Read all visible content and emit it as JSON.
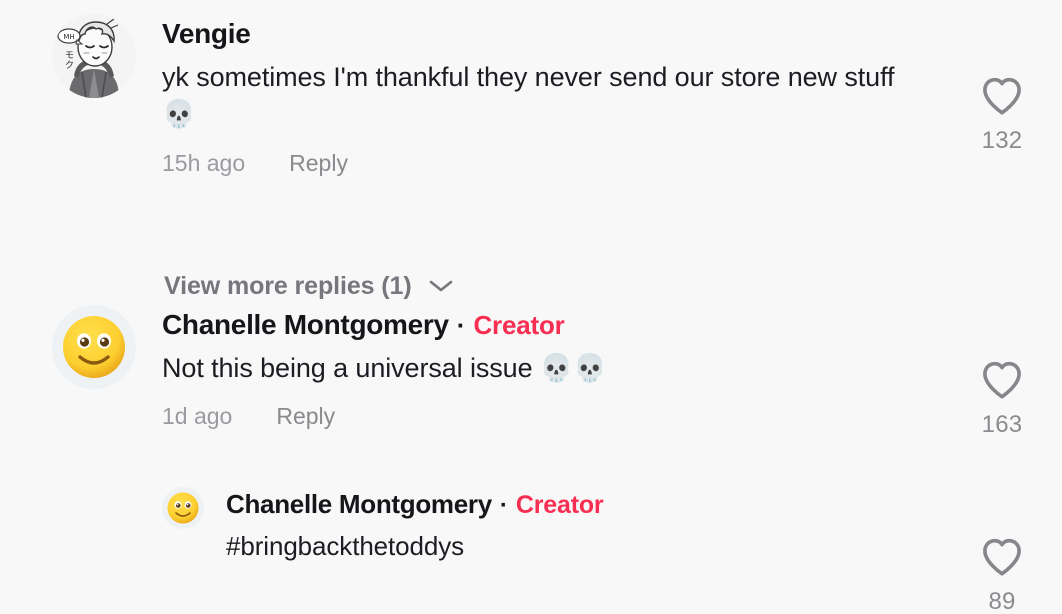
{
  "app": {
    "surface": "tiktok-comment-list",
    "background_color": "#f8f8f8",
    "accent_color": "#f82e52",
    "text_color": "#16161a",
    "muted_text_color": "#8a8a8f"
  },
  "comments": [
    {
      "id": "vengie",
      "author": "Vengie",
      "is_creator": false,
      "badge_label": "",
      "separator": "·",
      "avatar_icon": "sketch-portrait-avatar",
      "text": "yk sometimes I'm thankful they never send our store new stuff 💀",
      "timestamp": "15h ago",
      "reply_label": "Reply",
      "like_count": "132",
      "like_icon": "heart-outline-icon",
      "view_replies_label": "View more replies (1)",
      "view_replies_icon": "chevron-down-icon"
    },
    {
      "id": "chanelle-top",
      "author": "Chanelle Montgomery",
      "is_creator": true,
      "badge_label": "Creator",
      "separator": "·",
      "avatar_icon": "smiling-face-emoji-avatar",
      "text": "Not this being a universal issue 💀💀",
      "timestamp": "1d ago",
      "reply_label": "Reply",
      "like_count": "163",
      "like_icon": "heart-outline-icon"
    },
    {
      "id": "chanelle-reply",
      "author": "Chanelle Montgomery",
      "is_creator": true,
      "badge_label": "Creator",
      "separator": "·",
      "avatar_icon": "smiling-face-emoji-avatar",
      "text": "#bringbackthetoddys",
      "timestamp": "",
      "reply_label": "",
      "like_count": "89",
      "like_icon": "heart-outline-icon"
    }
  ]
}
